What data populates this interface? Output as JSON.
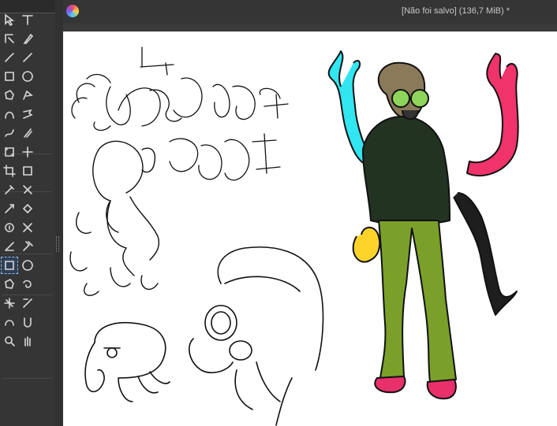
{
  "window": {
    "title": "[Não foi salvo]  (136,7 MiB) *",
    "app_icon": "krita-icon"
  },
  "toolbox": {
    "tools": [
      {
        "name": "select-shapes-icon"
      },
      {
        "name": "text-icon"
      },
      {
        "name": "edit-shapes-icon"
      },
      {
        "name": "calligraphy-icon"
      },
      {
        "name": "freehand-brush-icon"
      },
      {
        "name": "line-icon"
      },
      {
        "name": "rectangle-icon"
      },
      {
        "name": "ellipse-icon"
      },
      {
        "name": "polygon-icon"
      },
      {
        "name": "polyline-icon"
      },
      {
        "name": "bezier-curve-icon"
      },
      {
        "name": "freehand-path-icon"
      },
      {
        "name": "dynamic-brush-icon"
      },
      {
        "name": "multibrush-icon"
      },
      {
        "name": "transform-icon"
      },
      {
        "name": "move-icon"
      },
      {
        "name": "crop-icon"
      },
      {
        "name": "gradient-icon"
      },
      {
        "name": "color-picker-icon"
      },
      {
        "name": "colorize-mask-icon"
      },
      {
        "name": "smart-patch-icon"
      },
      {
        "name": "fill-icon"
      },
      {
        "name": "enclosed-fill-icon"
      },
      {
        "name": "assistant-icon"
      },
      {
        "name": "measure-icon"
      },
      {
        "name": "reference-icon"
      },
      {
        "name": "rectangular-selection-icon",
        "active": true
      },
      {
        "name": "elliptical-selection-icon"
      },
      {
        "name": "polygonal-selection-icon"
      },
      {
        "name": "freehand-selection-icon"
      },
      {
        "name": "contiguous-selection-icon"
      },
      {
        "name": "similar-color-selection-icon"
      },
      {
        "name": "bezier-selection-icon"
      },
      {
        "name": "magnetic-selection-icon"
      },
      {
        "name": "zoom-icon"
      },
      {
        "name": "pan-icon"
      }
    ]
  },
  "colors": {
    "toolbox_bg": "#353535",
    "active_tool": "#8fb4e8",
    "canvas_bg": "#ffffff",
    "arm_cyan": "#31e6f0",
    "arm_pink": "#f0336a",
    "arm_yellow": "#ffd42a",
    "arm_black": "#1e1e1e",
    "hoodie": "#223322",
    "pants": "#7aa02a",
    "shoes": "#e8306a",
    "mask_lens": "#8ed45a"
  }
}
